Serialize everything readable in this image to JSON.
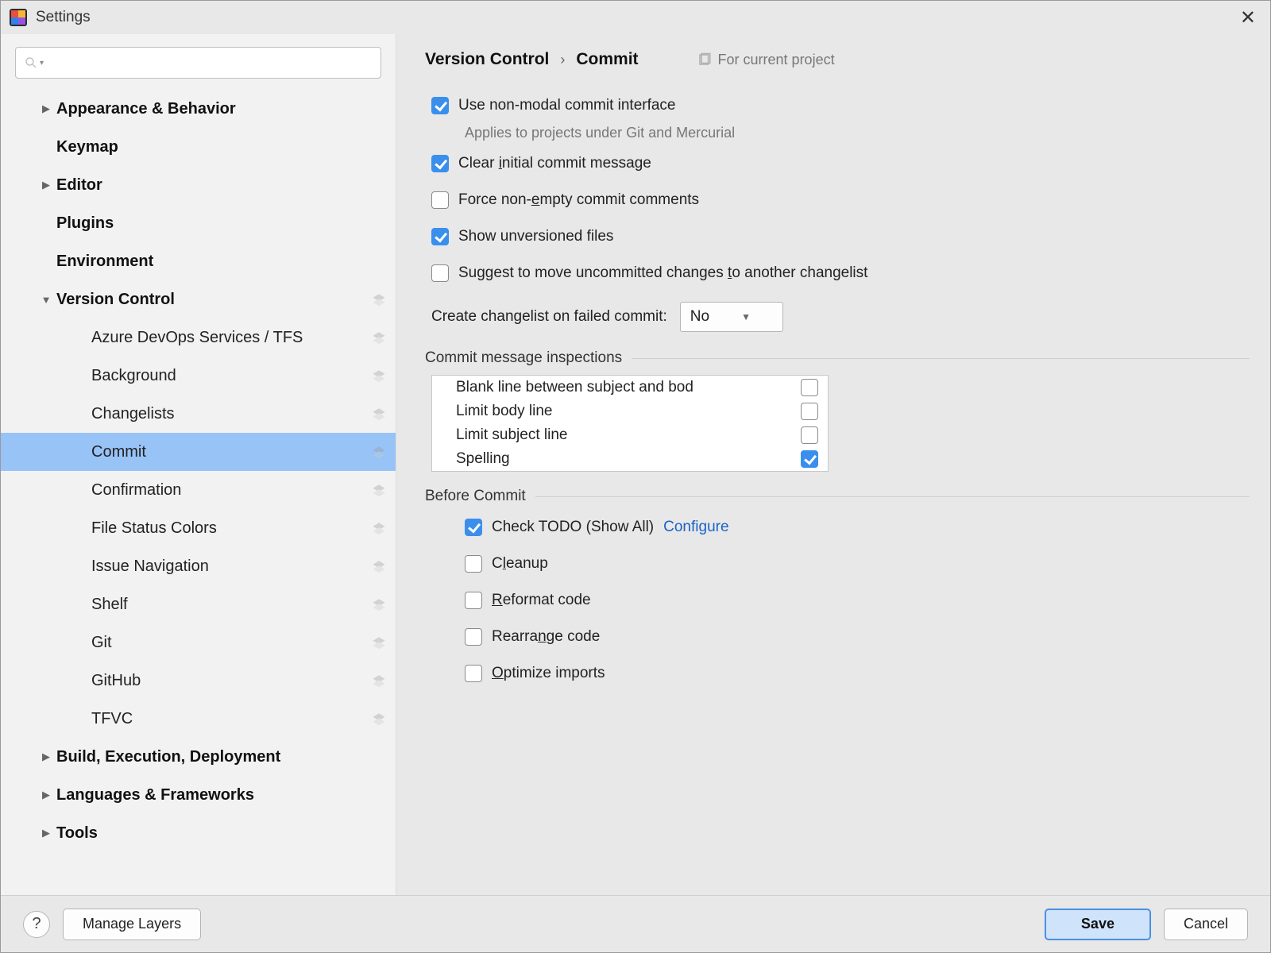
{
  "window": {
    "title": "Settings"
  },
  "sidebar": {
    "search_placeholder": "",
    "items": [
      {
        "label": "Appearance & Behavior",
        "bold": true,
        "indent": 1,
        "caret": "right"
      },
      {
        "label": "Keymap",
        "bold": true,
        "indent": 1,
        "caret": "none"
      },
      {
        "label": "Editor",
        "bold": true,
        "indent": 1,
        "caret": "right"
      },
      {
        "label": "Plugins",
        "bold": true,
        "indent": 1,
        "caret": "none"
      },
      {
        "label": "Environment",
        "bold": true,
        "indent": 1,
        "caret": "none"
      },
      {
        "label": "Version Control",
        "bold": true,
        "indent": 1,
        "caret": "down",
        "layers": true
      },
      {
        "label": "Azure DevOps Services / TFS",
        "bold": false,
        "indent": 2,
        "caret": "none",
        "layers": true
      },
      {
        "label": "Background",
        "bold": false,
        "indent": 2,
        "caret": "none",
        "layers": true
      },
      {
        "label": "Changelists",
        "bold": false,
        "indent": 2,
        "caret": "none",
        "layers": true
      },
      {
        "label": "Commit",
        "bold": false,
        "indent": 2,
        "caret": "none",
        "layers": true,
        "selected": true
      },
      {
        "label": "Confirmation",
        "bold": false,
        "indent": 2,
        "caret": "none",
        "layers": true
      },
      {
        "label": "File Status Colors",
        "bold": false,
        "indent": 2,
        "caret": "none",
        "layers": true
      },
      {
        "label": "Issue Navigation",
        "bold": false,
        "indent": 2,
        "caret": "none",
        "layers": true
      },
      {
        "label": "Shelf",
        "bold": false,
        "indent": 2,
        "caret": "none",
        "layers": true
      },
      {
        "label": "Git",
        "bold": false,
        "indent": 2,
        "caret": "none",
        "layers": true
      },
      {
        "label": "GitHub",
        "bold": false,
        "indent": 2,
        "caret": "none",
        "layers": true
      },
      {
        "label": "TFVC",
        "bold": false,
        "indent": 2,
        "caret": "none",
        "layers": true
      },
      {
        "label": "Build, Execution, Deployment",
        "bold": true,
        "indent": 1,
        "caret": "right"
      },
      {
        "label": "Languages & Frameworks",
        "bold": true,
        "indent": 1,
        "caret": "right"
      },
      {
        "label": "Tools",
        "bold": true,
        "indent": 1,
        "caret": "right"
      }
    ]
  },
  "breadcrumb": {
    "parent": "Version Control",
    "current": "Commit",
    "scope": "For current project"
  },
  "options": {
    "use_nonmodal": {
      "label": "Use non-modal commit interface",
      "checked": true,
      "desc": "Applies to projects under Git and Mercurial"
    },
    "clear_initial": {
      "pre": "Clear ",
      "u": "i",
      "post": "nitial commit message",
      "checked": true
    },
    "force_nonempty": {
      "pre": "Force non-",
      "u": "e",
      "post": "mpty commit comments",
      "checked": false
    },
    "show_unversioned": {
      "label": "Show unversioned files",
      "checked": true
    },
    "suggest_move": {
      "pre": "Suggest to move uncommitted changes ",
      "u": "t",
      "post": "o another changelist",
      "checked": false
    },
    "create_changelist_label": "Create changelist on failed commit:",
    "create_changelist_value": "No"
  },
  "inspections_title": "Commit message inspections",
  "inspections": [
    {
      "label": "Blank line between subject and bod",
      "checked": false
    },
    {
      "label": "Limit body line",
      "checked": false
    },
    {
      "label": "Limit subject line",
      "checked": false
    },
    {
      "label": "Spelling",
      "checked": true
    }
  ],
  "before_commit_title": "Before Commit",
  "before_commit": {
    "check_todo": {
      "label": "Check TODO (Show All)",
      "link": "Configure",
      "checked": true
    },
    "cleanup": {
      "pre": "C",
      "u": "l",
      "post": "eanup",
      "checked": false
    },
    "reformat": {
      "pre": "",
      "u": "R",
      "post": "eformat code",
      "checked": false
    },
    "rearrange": {
      "pre": "Rearra",
      "u": "n",
      "post": "ge code",
      "checked": false
    },
    "optimize": {
      "pre": "",
      "u": "O",
      "post": "ptimize imports",
      "checked": false
    }
  },
  "footer": {
    "help": "?",
    "manage_layers": "Manage Layers",
    "save": "Save",
    "cancel": "Cancel"
  }
}
